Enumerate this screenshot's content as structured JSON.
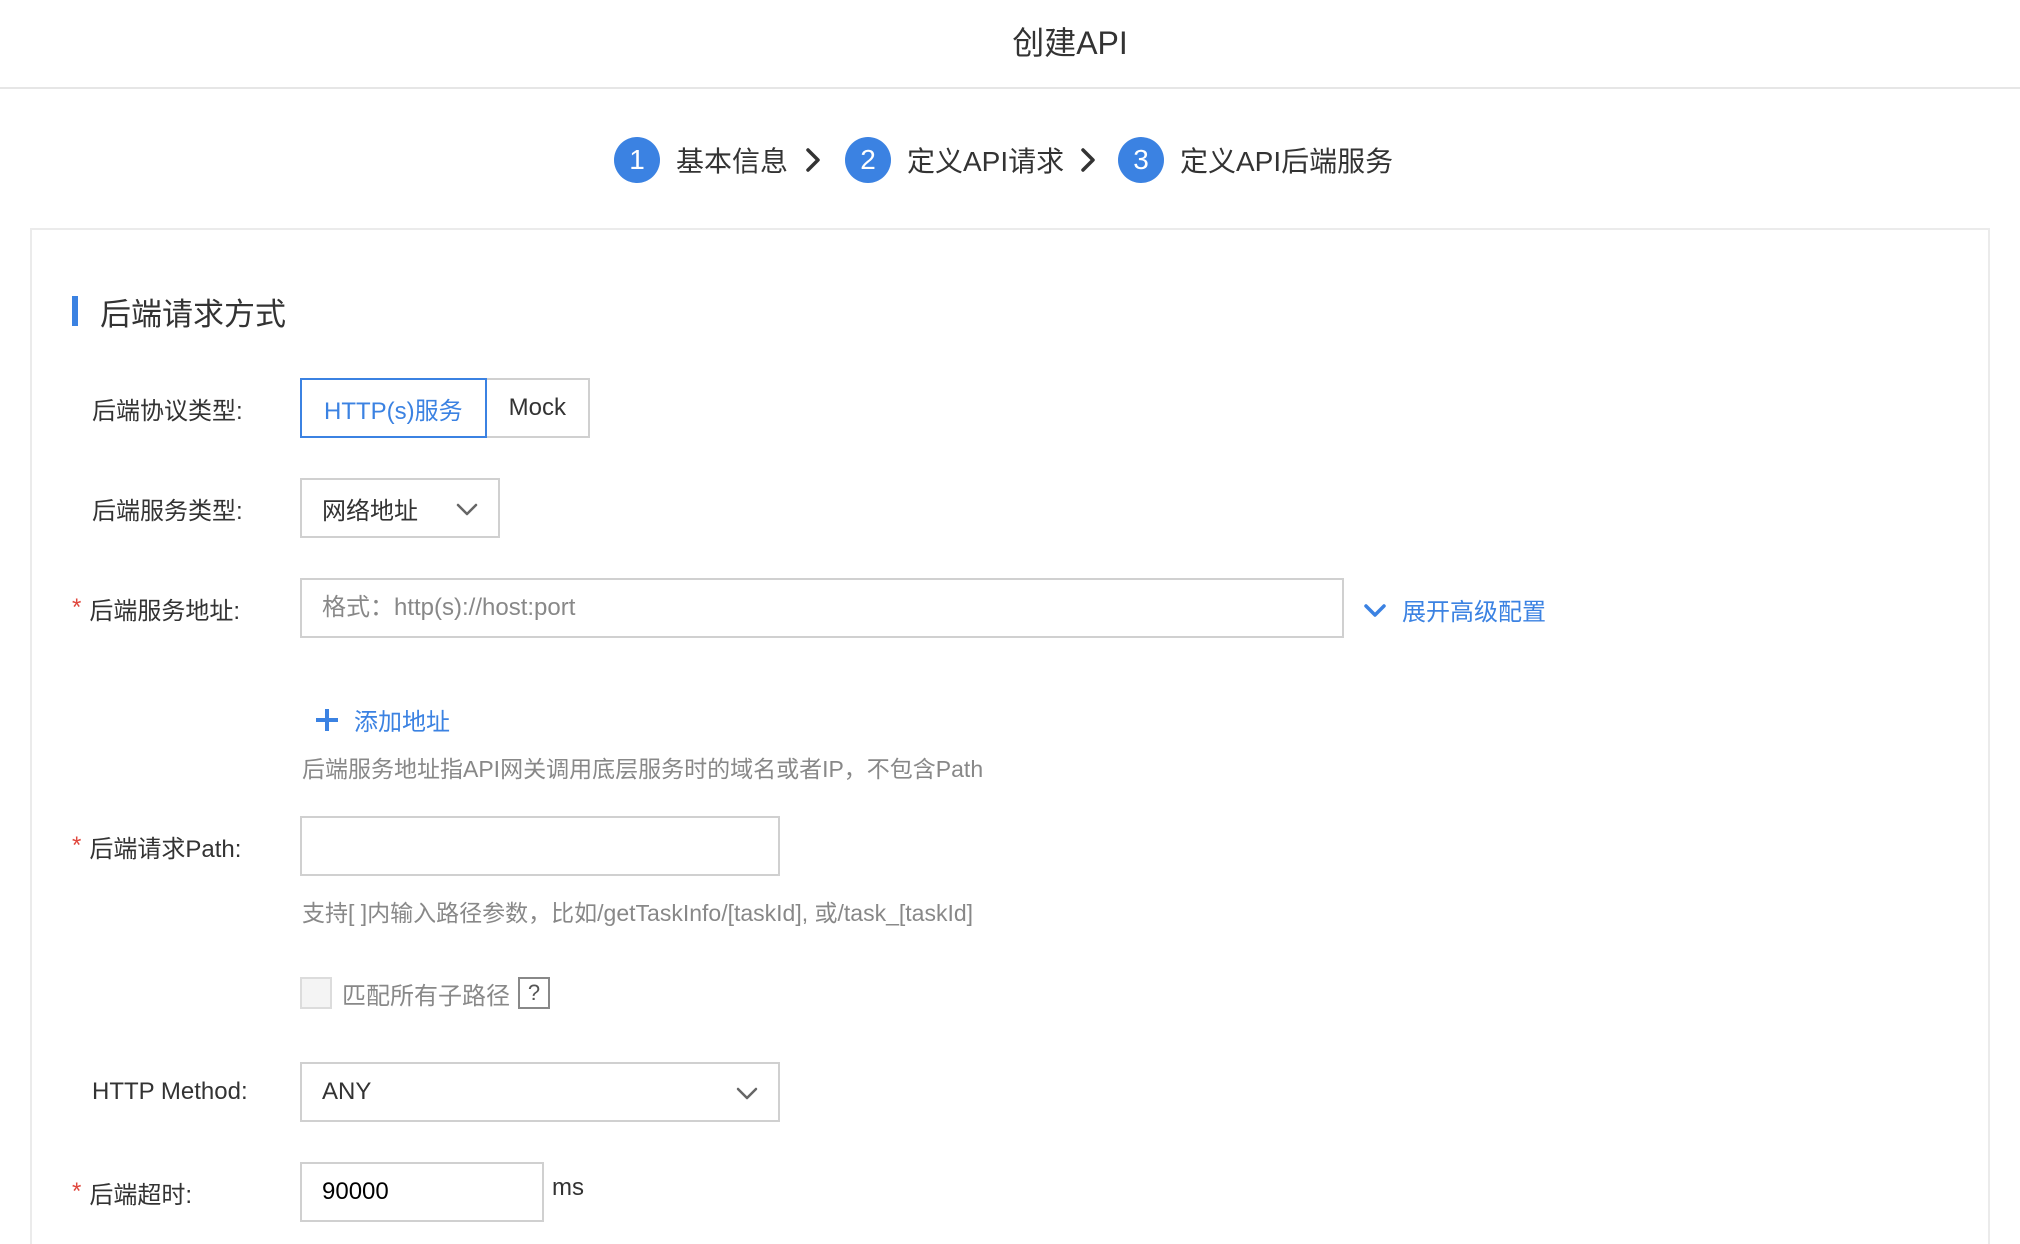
{
  "header": {
    "title": "创建API"
  },
  "steps": [
    {
      "number": "1",
      "label": "基本信息"
    },
    {
      "number": "2",
      "label": "定义API请求"
    },
    {
      "number": "3",
      "label": "定义API后端服务"
    }
  ],
  "section": {
    "title": "后端请求方式"
  },
  "protocol": {
    "label": "后端协议类型:",
    "options": [
      "HTTP(s)服务",
      "Mock"
    ],
    "selected": "HTTP(s)服务"
  },
  "service_type": {
    "label": "后端服务类型:",
    "value": "网络地址"
  },
  "service_address": {
    "required_mark": "*",
    "label": "后端服务地址:",
    "placeholder": "格式：http(s)://host:port",
    "value": "",
    "advanced_link": "展开高级配置",
    "add_link": "添加地址",
    "hint": "后端服务地址指API网关调用底层服务时的域名或者IP，不包含Path"
  },
  "backend_path": {
    "required_mark": "*",
    "label": "后端请求Path:",
    "value": "",
    "hint": "支持[ ]内输入路径参数，比如/getTaskInfo/[taskId], 或/task_[taskId]",
    "match_all_label": "匹配所有子路径",
    "help_mark": "?"
  },
  "http_method": {
    "label": "HTTP Method:",
    "value": "ANY"
  },
  "timeout": {
    "required_mark": "*",
    "label": "后端超时:",
    "value": "90000",
    "unit": "ms"
  },
  "colors": {
    "accent": "#3b82e2",
    "required": "#e0473d",
    "border": "#d0d0d0",
    "hint": "#888888"
  }
}
